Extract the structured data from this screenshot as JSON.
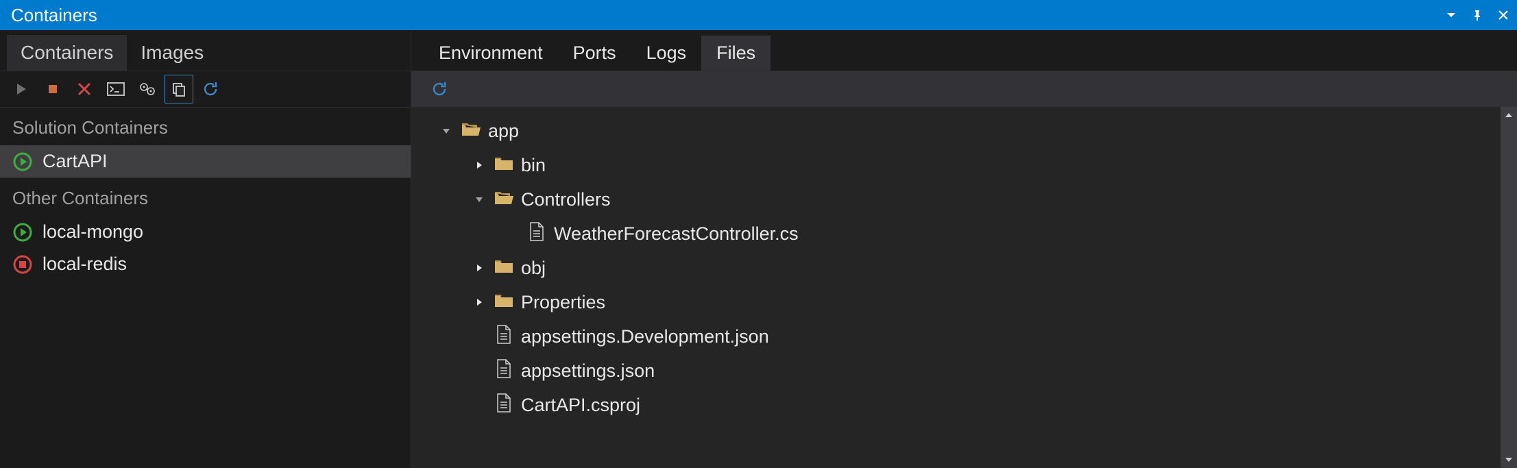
{
  "window_title": "Containers",
  "left": {
    "tabs": [
      {
        "label": "Containers",
        "active": true
      },
      {
        "label": "Images",
        "active": false
      }
    ],
    "sections": [
      {
        "header": "Solution Containers",
        "items": [
          {
            "name": "CartAPI",
            "status": "running",
            "selected": true
          }
        ]
      },
      {
        "header": "Other Containers",
        "items": [
          {
            "name": "local-mongo",
            "status": "running",
            "selected": false
          },
          {
            "name": "local-redis",
            "status": "stopped",
            "selected": false
          }
        ]
      }
    ]
  },
  "right": {
    "tabs": [
      {
        "label": "Environment",
        "active": false
      },
      {
        "label": "Ports",
        "active": false
      },
      {
        "label": "Logs",
        "active": false
      },
      {
        "label": "Files",
        "active": true
      }
    ],
    "tree": [
      {
        "depth": 0,
        "expand": "open",
        "kind": "folder-open",
        "label": "app"
      },
      {
        "depth": 1,
        "expand": "closed",
        "kind": "folder-closed",
        "label": "bin"
      },
      {
        "depth": 1,
        "expand": "open",
        "kind": "folder-open",
        "label": "Controllers"
      },
      {
        "depth": 2,
        "expand": "none",
        "kind": "file",
        "label": "WeatherForecastController.cs"
      },
      {
        "depth": 1,
        "expand": "closed",
        "kind": "folder-closed",
        "label": "obj"
      },
      {
        "depth": 1,
        "expand": "closed",
        "kind": "folder-closed",
        "label": "Properties"
      },
      {
        "depth": 1,
        "expand": "none",
        "kind": "file",
        "label": "appsettings.Development.json"
      },
      {
        "depth": 1,
        "expand": "none",
        "kind": "file",
        "label": "appsettings.json"
      },
      {
        "depth": 1,
        "expand": "none",
        "kind": "file",
        "label": "CartAPI.csproj"
      }
    ]
  }
}
